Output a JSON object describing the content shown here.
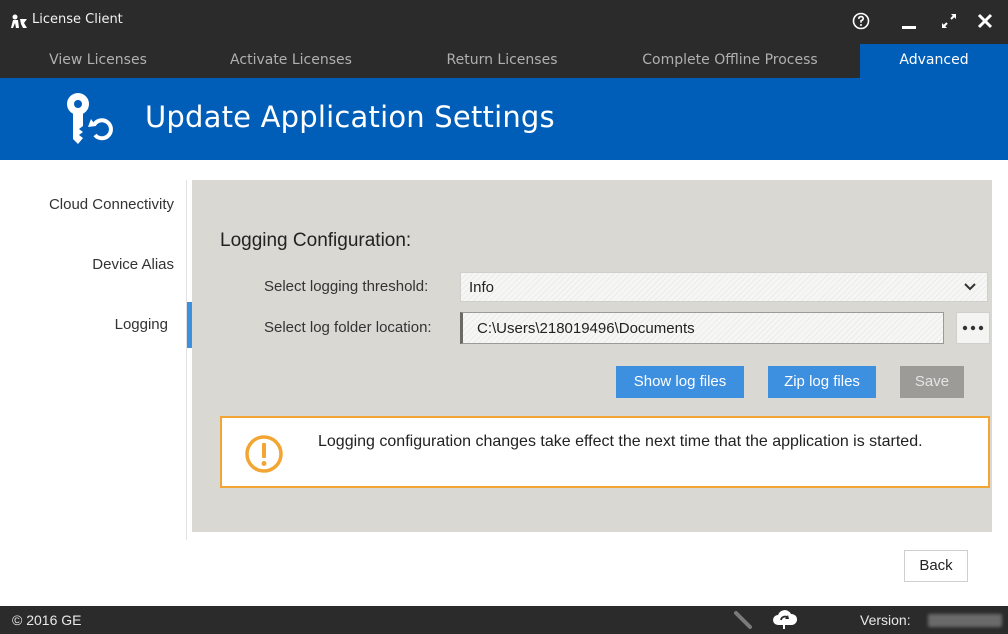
{
  "window": {
    "title": "License Client",
    "help_icon": "help-circle-icon",
    "minimize_icon": "minimize-icon",
    "maximize_icon": "maximize-icon",
    "close_icon": "close-icon"
  },
  "tabs": [
    {
      "label": "View Licenses",
      "active": false
    },
    {
      "label": "Activate Licenses",
      "active": false
    },
    {
      "label": "Return Licenses",
      "active": false
    },
    {
      "label": "Complete Offline Process",
      "active": false
    },
    {
      "label": "Advanced",
      "active": true
    }
  ],
  "header": {
    "title": "Update Application Settings",
    "icon": "key-refresh-icon"
  },
  "sidebar": {
    "items": [
      {
        "label": "Cloud Connectivity",
        "active": false
      },
      {
        "label": "Device Alias",
        "active": false
      },
      {
        "label": "Logging",
        "active": true
      }
    ]
  },
  "logging": {
    "section_title": "Logging Configuration:",
    "threshold_label": "Select logging threshold:",
    "threshold_value": "Info",
    "folder_label": "Select log folder location:",
    "folder_value": "C:\\Users\\218019496\\Documents",
    "browse_label": "•••",
    "show_logs_label": "Show log files",
    "zip_logs_label": "Zip log files",
    "save_label": "Save",
    "alert_text": "Logging configuration changes take effect the next time that the application is started."
  },
  "back_label": "Back",
  "status": {
    "copyright": "© 2016 GE",
    "version_label": "Version:"
  },
  "colors": {
    "accent": "#005eb8",
    "button_blue": "#3d8fe0",
    "warning": "#f2a533",
    "chrome": "#2b2b2b"
  }
}
